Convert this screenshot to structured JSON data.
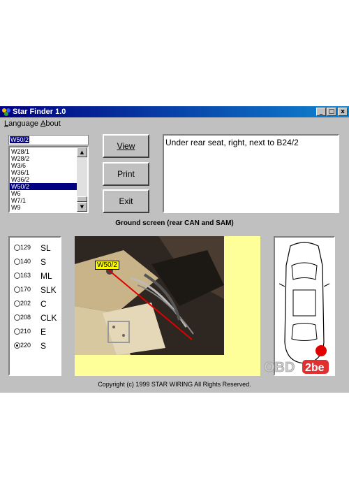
{
  "window": {
    "title": "Star Finder 1.0",
    "controls": [
      "_",
      "□",
      "x"
    ]
  },
  "menu": {
    "items": [
      "Language",
      "About"
    ]
  },
  "combo": {
    "value": "W50/2"
  },
  "list": {
    "items": [
      "W28/1",
      "W28/2",
      "W3/6",
      "W36/1",
      "W36/2",
      "W50/2",
      "W6",
      "W7/1",
      "W9"
    ],
    "selected_index": 5
  },
  "buttons": {
    "view": "View",
    "print": "Print",
    "exit": "Exit"
  },
  "description": {
    "text": "Under rear seat, right, next to B24/2"
  },
  "caption": {
    "text": "Ground screen (rear CAN and SAM)"
  },
  "models": [
    {
      "num": "129",
      "name": "SL",
      "checked": false
    },
    {
      "num": "140",
      "name": "S",
      "checked": false
    },
    {
      "num": "163",
      "name": "ML",
      "checked": false
    },
    {
      "num": "170",
      "name": "SLK",
      "checked": false
    },
    {
      "num": "202",
      "name": "C",
      "checked": false
    },
    {
      "num": "208",
      "name": "CLK",
      "checked": false
    },
    {
      "num": "210",
      "name": "E",
      "checked": false
    },
    {
      "num": "220",
      "name": "S",
      "checked": true
    }
  ],
  "photo": {
    "tag": "W50/2"
  },
  "footer": {
    "copyright": "Copyright (c) 1999 STAR WIRING  All Rights Reserved."
  },
  "logo": {
    "text_a": "OBD",
    "text_b": "2be"
  },
  "colors": {
    "title_bar": "#000080",
    "photo_bg": "#ffff99",
    "location_dot": "#e00000",
    "wire_line": "#e00000"
  }
}
